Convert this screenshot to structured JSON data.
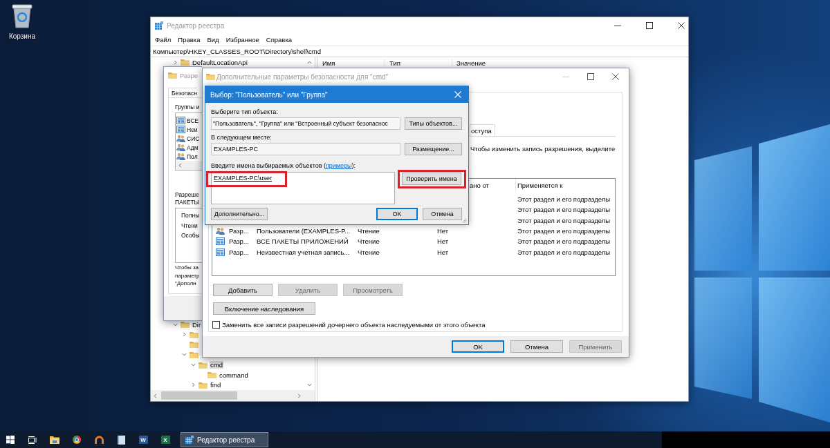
{
  "desktop": {
    "icons": [
      {
        "label": "Корзина"
      }
    ]
  },
  "registry_editor": {
    "title": "Редактор реестра",
    "active": false,
    "menu": [
      "Файл",
      "Правка",
      "Вид",
      "Избранное",
      "Справка"
    ],
    "address": "Компьютер\\HKEY_CLASSES_ROOT\\Directory\\shell\\cmd",
    "tree": [
      {
        "label": "DefaultLocationApi",
        "expandable": true,
        "expanded": false,
        "selected": false
      },
      {
        "label": "Dir",
        "expandable": true,
        "expanded": true,
        "selected": false,
        "children": [
          {
            "expandable": true,
            "expanded": false,
            "selected": false
          },
          {
            "expandable": false,
            "expanded": false,
            "selected": false
          },
          {
            "expandable": true,
            "expanded": true,
            "selected": false,
            "children": [
              {
                "label": "cmd",
                "expandable": true,
                "expanded": true,
                "selected": true,
                "children": [
                  {
                    "label": "command",
                    "expandable": false,
                    "expanded": false,
                    "selected": false
                  }
                ]
              },
              {
                "label": "find",
                "expandable": true,
                "expanded": false,
                "selected": false
              }
            ]
          }
        ]
      }
    ],
    "columns": [
      "Имя",
      "Тип",
      "Значение"
    ]
  },
  "permissions_dialog": {
    "title": "Разре",
    "active": false,
    "tab": {
      "label": "Безопасн",
      "selected": true
    },
    "groups_label": "Группы и",
    "groups": [
      {
        "kind": "package",
        "name": "ВСЕ"
      },
      {
        "kind": "package",
        "name": "Неи"
      },
      {
        "kind": "group",
        "name": "СИС"
      },
      {
        "kind": "group",
        "name": "Адм"
      },
      {
        "kind": "group",
        "name": "Пол"
      }
    ],
    "permissions_label": [
      "Разреше",
      "ПАКЕТЫ"
    ],
    "permissions": [
      "Полны",
      "Чтени",
      "Особы"
    ],
    "note": [
      "Чтобы за",
      "параметр",
      "\"Дополн"
    ]
  },
  "advanced_security": {
    "title": "Дополнительные параметры безопасности для \"cmd\"",
    "active": false,
    "tabs": [
      {
        "label": "оступа",
        "selected": false
      }
    ],
    "instruction": "Чтобы изменить запись разрешения, выделите",
    "table": {
      "columns": [
        "ано от",
        "Применяется к"
      ],
      "rows": [
        {
          "applies_to": "Этот раздел и его подразделы",
          "selected": false
        },
        {
          "applies_to": "Этот раздел и его подразделы",
          "selected": false
        },
        {
          "applies_to": "Этот раздел и его подразделы",
          "selected": false
        },
        {
          "kind": "group",
          "type": "Разр...",
          "principal": "Пользователи (EXAMPLES-P...",
          "access": "Чтение",
          "inherited": "Нет",
          "applies_to": "Этот раздел и его подразделы",
          "selected": false
        },
        {
          "kind": "package",
          "type": "Разр...",
          "principal": "ВСЕ ПАКЕТЫ ПРИЛОЖЕНИЙ",
          "access": "Чтение",
          "inherited": "Нет",
          "applies_to": "Этот раздел и его подразделы",
          "selected": false
        },
        {
          "kind": "package",
          "type": "Разр...",
          "principal": "Неизвестная учетная запись...",
          "access": "Чтение",
          "inherited": "Нет",
          "applies_to": "Этот раздел и его подразделы",
          "selected": false
        }
      ]
    },
    "buttons": [
      {
        "label": "Добавить",
        "disabled": false
      },
      {
        "label": "Удалить",
        "disabled": true
      },
      {
        "label": "Просмотреть",
        "disabled": true
      }
    ],
    "inheritance_button": "Включение наследования",
    "replace_checkbox": {
      "label": "Заменить все записи разрешений дочернего объекта наследуемыми от этого объекта",
      "checked": false
    },
    "footer_buttons": [
      {
        "label": "OK",
        "default": true,
        "disabled": false
      },
      {
        "label": "Отмена",
        "default": false,
        "disabled": false
      },
      {
        "label": "Применить",
        "default": false,
        "disabled": true
      }
    ]
  },
  "select_dialog": {
    "title": "Выбор: \"Пользователь\" или \"Группа\"",
    "active": true,
    "object_type_label": "Выберите тип объекта:",
    "object_type": "\"Пользователь\", \"Группа\" или \"Встроенный субъект безопаснос",
    "object_types_button": "Типы объектов...",
    "location_label": "В следующем месте:",
    "location": "EXAMPLES-PC",
    "location_button": "Размещение...",
    "names_label": {
      "text": "Введите имена выбираемых объектов (",
      "link": "примеры",
      "end": "):"
    },
    "names": {
      "value": "EXAMPLES-PC\\user",
      "resolved": true,
      "highlighted": true
    },
    "check_names_button": {
      "label": "Проверить имена",
      "highlighted": true
    },
    "advanced_button": "Дополнительно...",
    "ok_button": "OK",
    "cancel_button": "Отмена"
  },
  "taskbar": {
    "buttons": [
      {
        "kind": "start"
      },
      {
        "kind": "task_view"
      },
      {
        "kind": "folder"
      },
      {
        "kind": "browser"
      },
      {
        "kind": "arc"
      },
      {
        "kind": "notebook"
      },
      {
        "kind": "letter_tile",
        "letter": "W",
        "color": "#2b5797"
      },
      {
        "kind": "letter_tile",
        "letter": "X",
        "color": "#1e7145"
      }
    ],
    "windows": [
      {
        "label": "Редактор реестра",
        "selected": true
      }
    ]
  }
}
